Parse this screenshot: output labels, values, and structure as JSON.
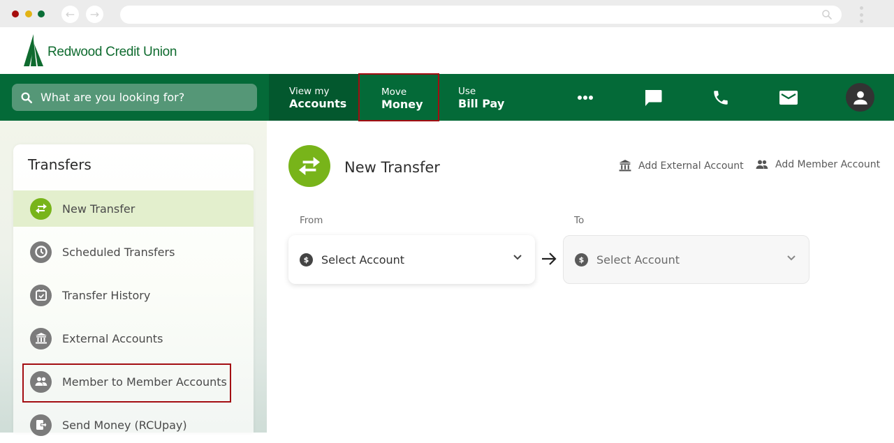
{
  "browser": {
    "traffic_lights": [
      "close",
      "minimize",
      "maximize"
    ],
    "back_icon": "arrow-left-icon",
    "forward_icon": "arrow-right-icon",
    "url": "",
    "menu_icon": "kebab-icon"
  },
  "brand": {
    "name": "Redwood Credit Union",
    "primary_color": "#046a38",
    "accent_color": "#78b41a",
    "highlight_color": "#a30d12"
  },
  "topnav": {
    "search_placeholder": "What are you looking for?",
    "tabs": [
      {
        "small": "View my",
        "big": "Accounts",
        "current": true
      },
      {
        "small": "Move",
        "big": "Money",
        "highlighted": true
      },
      {
        "small": "Use",
        "big": "Bill Pay"
      }
    ],
    "icons": [
      "more-icon",
      "chat-icon",
      "phone-icon",
      "mail-icon",
      "profile-icon"
    ]
  },
  "sidebar": {
    "title": "Transfers",
    "items": [
      {
        "label": "New Transfer",
        "icon": "transfer-icon",
        "active": true
      },
      {
        "label": "Scheduled Transfers",
        "icon": "clock-icon"
      },
      {
        "label": "Transfer History",
        "icon": "calendar-check-icon"
      },
      {
        "label": "External Accounts",
        "icon": "bank-icon"
      },
      {
        "label": "Member to Member Accounts",
        "icon": "members-icon",
        "highlighted": true
      },
      {
        "label": "Send Money (RCUpay)",
        "icon": "send-money-icon"
      }
    ]
  },
  "main": {
    "title": "New Transfer",
    "links": [
      {
        "label": "Add External Account",
        "icon": "bank-icon"
      },
      {
        "label": "Add Member Account",
        "icon": "members-icon"
      }
    ],
    "from": {
      "label": "From",
      "placeholder": "Select Account"
    },
    "to": {
      "label": "To",
      "placeholder": "Select Account",
      "disabled": true
    }
  }
}
